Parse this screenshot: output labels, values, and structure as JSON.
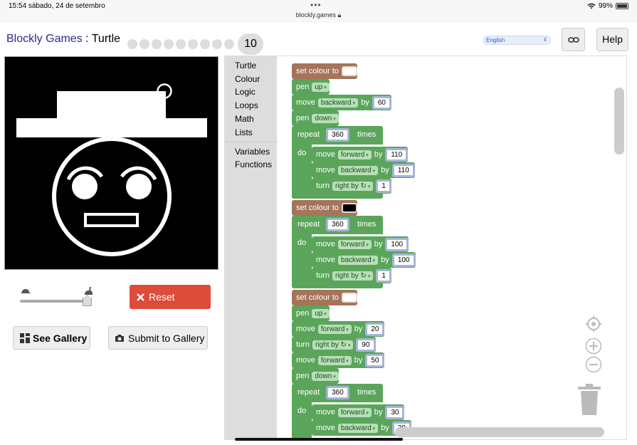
{
  "statusbar": {
    "time": "15:54",
    "date": "sábado, 24 de setembro",
    "url": "blockly.games",
    "battery": "99%"
  },
  "header": {
    "app_link": "Blockly Games",
    "separator": " : ",
    "app_name": "Turtle",
    "level_current": "10",
    "language": "English",
    "help_label": "Help"
  },
  "controls": {
    "reset_label": "Reset",
    "see_gallery_label": "See Gallery",
    "submit_label": "Submit to Gallery"
  },
  "toolbox": {
    "categories": [
      "Turtle",
      "Colour",
      "Logic",
      "Loops",
      "Math",
      "Lists",
      "Variables",
      "Functions"
    ]
  },
  "blocks": {
    "set_colour": "set colour to",
    "pen": "pen",
    "up": "up",
    "down": "down",
    "move": "move",
    "forward": "forward",
    "backward": "backward",
    "by": "by",
    "turn": "turn",
    "right_by": "right by ↻",
    "repeat": "repeat",
    "times": "times",
    "do": "do",
    "values": {
      "v60": "60",
      "v360": "360",
      "v110": "110",
      "v1": "1",
      "v100": "100",
      "v20": "20",
      "v90": "90",
      "v50": "50",
      "v30": "30"
    },
    "colours": {
      "white": "#ffffff",
      "black": "#000000"
    }
  },
  "colors": {
    "accent": "#dd4b39",
    "colour_block": "#a5745b",
    "turtle_block": "#5ba55b"
  }
}
